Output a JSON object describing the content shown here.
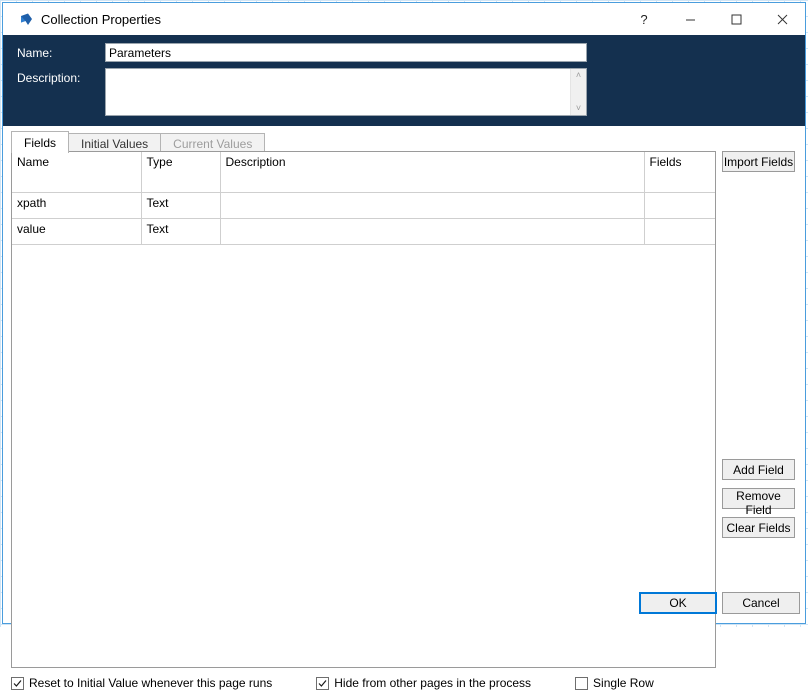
{
  "window": {
    "title": "Collection Properties",
    "icon": "blue-prism-logo-icon",
    "buttons": {
      "help": "?",
      "minimize": "—",
      "maximize": "□",
      "close": "✕"
    }
  },
  "header": {
    "name_label": "Name:",
    "name_value": "Parameters",
    "name_placeholder": "",
    "description_label": "Description:",
    "description_value": "",
    "description_placeholder": "",
    "scroll_up": "˄",
    "scroll_down": "˅",
    "bg_color": "#14304f"
  },
  "tabs": [
    {
      "label": "Fields",
      "active": true,
      "disabled": false
    },
    {
      "label": "Initial Values",
      "active": false,
      "disabled": false
    },
    {
      "label": "Current Values",
      "active": false,
      "disabled": true
    }
  ],
  "grid": {
    "columns": [
      "Name",
      "Type",
      "Description",
      "Fields"
    ],
    "rows": [
      {
        "name": "xpath",
        "type": "Text",
        "description": "",
        "fields": ""
      },
      {
        "name": "value",
        "type": "Text",
        "description": "",
        "fields": ""
      }
    ]
  },
  "side_buttons": {
    "import_fields": "Import Fields",
    "add_field": "Add Field",
    "remove_field": "Remove Field",
    "clear_fields": "Clear Fields"
  },
  "options": [
    {
      "label": "Reset to Initial Value whenever this page runs",
      "checked": true
    },
    {
      "label": "Hide from other pages in the process",
      "checked": true
    },
    {
      "label": "Single Row",
      "checked": false
    }
  ],
  "footer": {
    "ok": "OK",
    "cancel": "Cancel"
  },
  "accent_color": "#0078d7"
}
